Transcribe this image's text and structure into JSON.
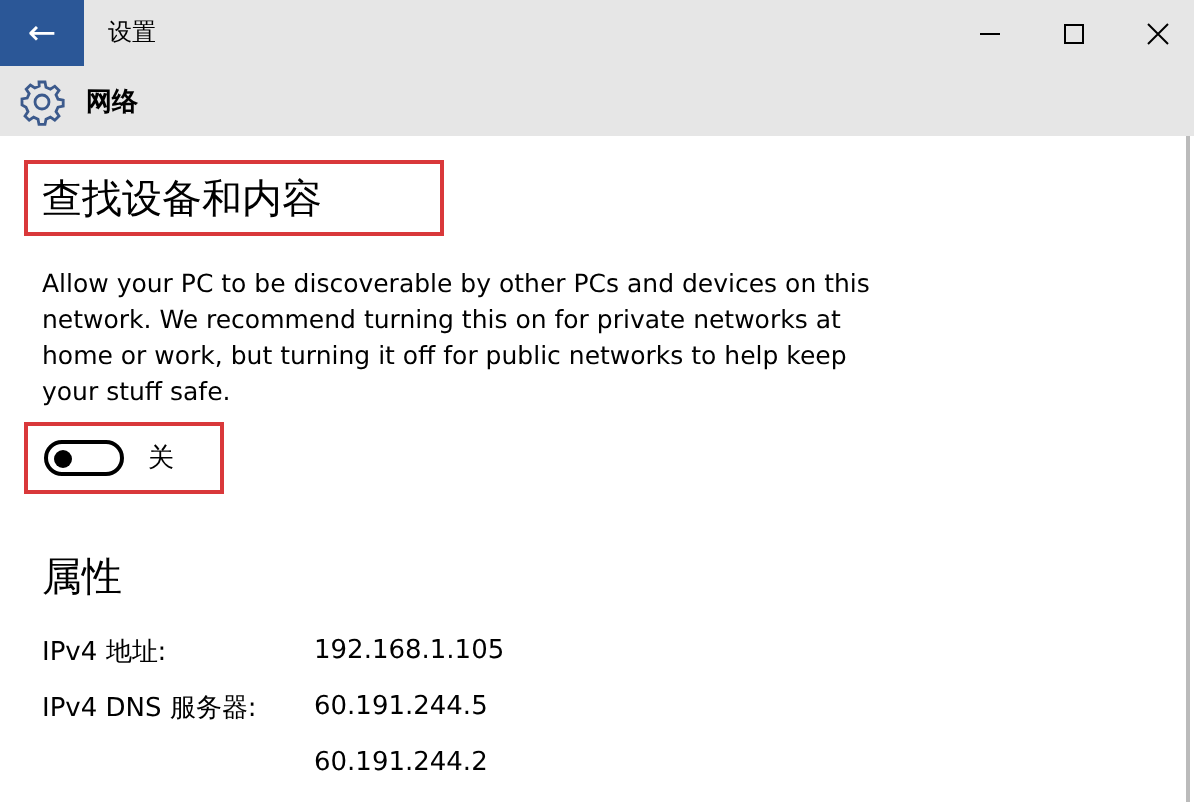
{
  "window": {
    "title": "设置",
    "back_icon": "←"
  },
  "header": {
    "title": "网络"
  },
  "discovery": {
    "heading": "查找设备和内容",
    "heading_highlighted": true,
    "description": "Allow your PC to be discoverable by other PCs and devices on this network. We recommend turning this on for private networks at home or work, but turning it off for public networks to help keep your stuff safe.",
    "toggle": {
      "on": false,
      "label": "关",
      "highlighted": true
    }
  },
  "properties": {
    "heading": "属性",
    "rows": [
      {
        "label": "IPv4 地址:",
        "value": "192.168.1.105"
      },
      {
        "label": "IPv4 DNS 服务器:",
        "value": "60.191.244.5"
      },
      {
        "label": "",
        "value": "60.191.244.2"
      }
    ]
  }
}
